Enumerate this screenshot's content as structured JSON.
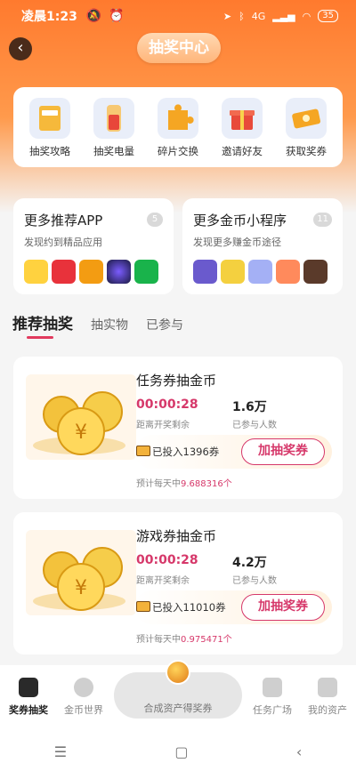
{
  "status_bar": {
    "time": "凌晨1:23",
    "network": "4G",
    "battery": "35"
  },
  "header": {
    "title": "抽奖中心"
  },
  "quick_actions": [
    {
      "label": "抽奖攻略",
      "icon": "guide-book-icon"
    },
    {
      "label": "抽奖电量",
      "icon": "battery-icon"
    },
    {
      "label": "碎片交换",
      "icon": "puzzle-icon"
    },
    {
      "label": "邀请好友",
      "icon": "gift-icon"
    },
    {
      "label": "获取奖券",
      "icon": "ticket-icon"
    }
  ],
  "promo": {
    "apps": {
      "title": "更多推荐APP",
      "count": "5",
      "subtitle": "发现约到精品应用"
    },
    "mini": {
      "title": "更多金币小程序",
      "count": "11",
      "subtitle": "发现更多赚金币途径"
    }
  },
  "tabs": [
    "推荐抽奖",
    "抽实物",
    "已参与"
  ],
  "lotteries": [
    {
      "title": "任务券抽金币",
      "timer": "00:00:28",
      "timer_label": "距离开奖剩余",
      "people": "1.6万",
      "people_label": "已参与人数",
      "invested": "已投入1396券",
      "button": "加抽奖券",
      "est_prefix": "预计每天中",
      "est_value": "9.688316个"
    },
    {
      "title": "游戏券抽金币",
      "timer": "00:00:28",
      "timer_label": "距离开奖剩余",
      "people": "4.2万",
      "people_label": "已参与人数",
      "invested": "已投入11010券",
      "button": "加抽奖券",
      "est_prefix": "预计每天中",
      "est_value": "0.975471个"
    }
  ],
  "bottom_nav": {
    "items": [
      "奖券抽奖",
      "金币世界",
      "任务广场",
      "我的资产"
    ],
    "center": "合成资产得奖券"
  },
  "colors": {
    "accent": "#d6386a",
    "header": "#ff7a2e"
  }
}
